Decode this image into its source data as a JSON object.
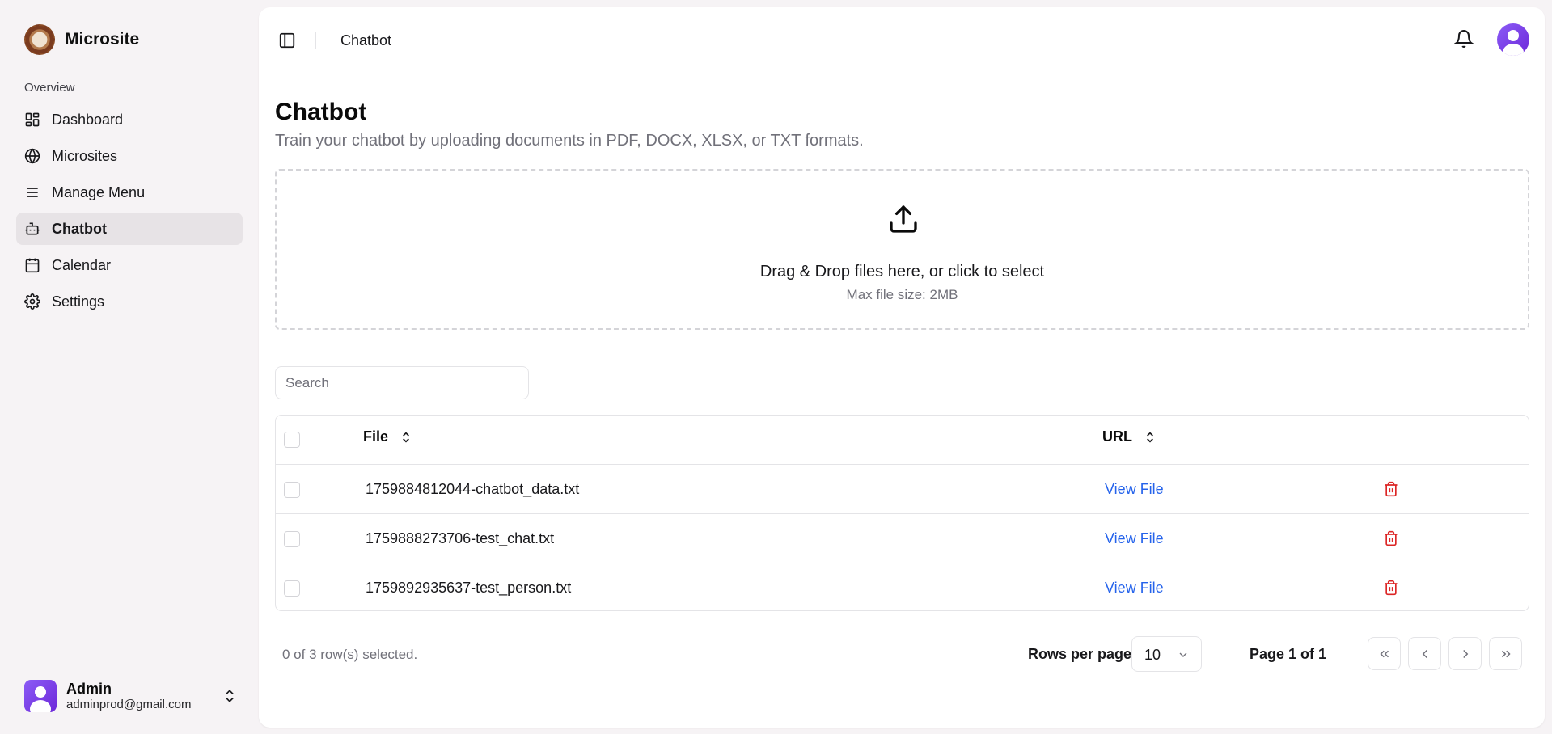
{
  "app": {
    "name": "Microsite"
  },
  "sidebar": {
    "section_label": "Overview",
    "items": [
      {
        "label": "Dashboard",
        "icon": "dashboard-icon",
        "active": false
      },
      {
        "label": "Microsites",
        "icon": "globe-icon",
        "active": false
      },
      {
        "label": "Manage Menu",
        "icon": "menu-icon",
        "active": false
      },
      {
        "label": "Chatbot",
        "icon": "bot-icon",
        "active": true
      },
      {
        "label": "Calendar",
        "icon": "calendar-icon",
        "active": false
      },
      {
        "label": "Settings",
        "icon": "gear-icon",
        "active": false
      }
    ],
    "user": {
      "name": "Admin",
      "email": "adminprod@gmail.com"
    }
  },
  "header": {
    "breadcrumb": "Chatbot"
  },
  "page": {
    "title": "Chatbot",
    "subtitle": "Train your chatbot by uploading documents in PDF, DOCX, XLSX, or TXT formats."
  },
  "dropzone": {
    "main_text": "Drag & Drop files here, or click to select",
    "sub_text": "Max file size: 2MB"
  },
  "search": {
    "placeholder": "Search",
    "value": ""
  },
  "table": {
    "columns": {
      "file": "File",
      "url": "URL"
    },
    "rows": [
      {
        "file": "1759884812044-chatbot_data.txt",
        "url": "View File"
      },
      {
        "file": "1759888273706-test_chat.txt",
        "url": "View File"
      },
      {
        "file": "1759892935637-test_person.txt",
        "url": "View File"
      }
    ]
  },
  "pagination": {
    "selection_text": "0 of 3 row(s) selected.",
    "rows_per_page_label": "Rows per page",
    "rows_per_page_value": "10",
    "page_info": "Page 1 of 1"
  },
  "colors": {
    "accent_link": "#2563eb",
    "danger": "#dc2626",
    "active_nav_bg": "#e7e3e6"
  }
}
